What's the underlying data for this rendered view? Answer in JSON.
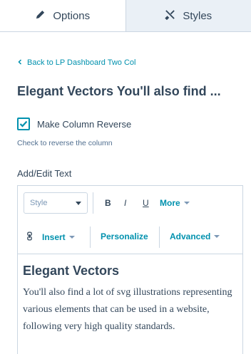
{
  "tabs": {
    "options_label": "Options",
    "styles_label": "Styles",
    "options_icon": "pencil-icon",
    "styles_icon": "brush-icon"
  },
  "back_link": {
    "label": "Back to LP Dashboard Two Col"
  },
  "module": {
    "title": "Elegant Vectors You'll also find ..."
  },
  "checkbox": {
    "label": "Make Column Reverse",
    "checked": true,
    "help": "Check to reverse the column"
  },
  "editor": {
    "field_label": "Add/Edit Text",
    "style_select": "Style",
    "bold": "B",
    "italic": "I",
    "underline": "U",
    "more": "More",
    "insert": "Insert",
    "personalize": "Personalize",
    "advanced": "Advanced",
    "heading": "Elegant Vectors",
    "body": "You'll also find a lot of svg illustrations representing various elements that can be used in a website, following very high quality standards."
  },
  "colors": {
    "accent": "#0091ae",
    "text": "#33475b",
    "border": "#cbd6e2",
    "tab_inactive": "#eaf0f6"
  }
}
